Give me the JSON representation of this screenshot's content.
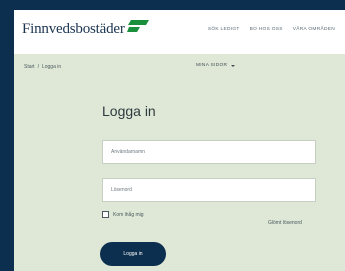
{
  "brand": {
    "name": "Finnvedsbostäder",
    "flag_color": "#1a8f3c",
    "accent": "#0d2f4f"
  },
  "nav": {
    "items": [
      "SÖK LEDIGT",
      "BO HOS OSS",
      "VÅRA OMRÅDEN"
    ]
  },
  "breadcrumb": {
    "home": "Start",
    "separator": "/",
    "current": "Logga in"
  },
  "pages_menu": {
    "label": "MINA SIDOR",
    "icon": "chevron-down-icon"
  },
  "login": {
    "title": "Logga in",
    "username_placeholder": "Användarnamn",
    "password_placeholder": "Lösenord",
    "remember_label": "Kom ihåg mig",
    "forgot_label": "Glömt lösenord",
    "submit_label": "Logga in"
  },
  "colors": {
    "page_background": "#0c2f4f",
    "content_background": "#dfe8d6",
    "header_background": "#ffffff"
  }
}
